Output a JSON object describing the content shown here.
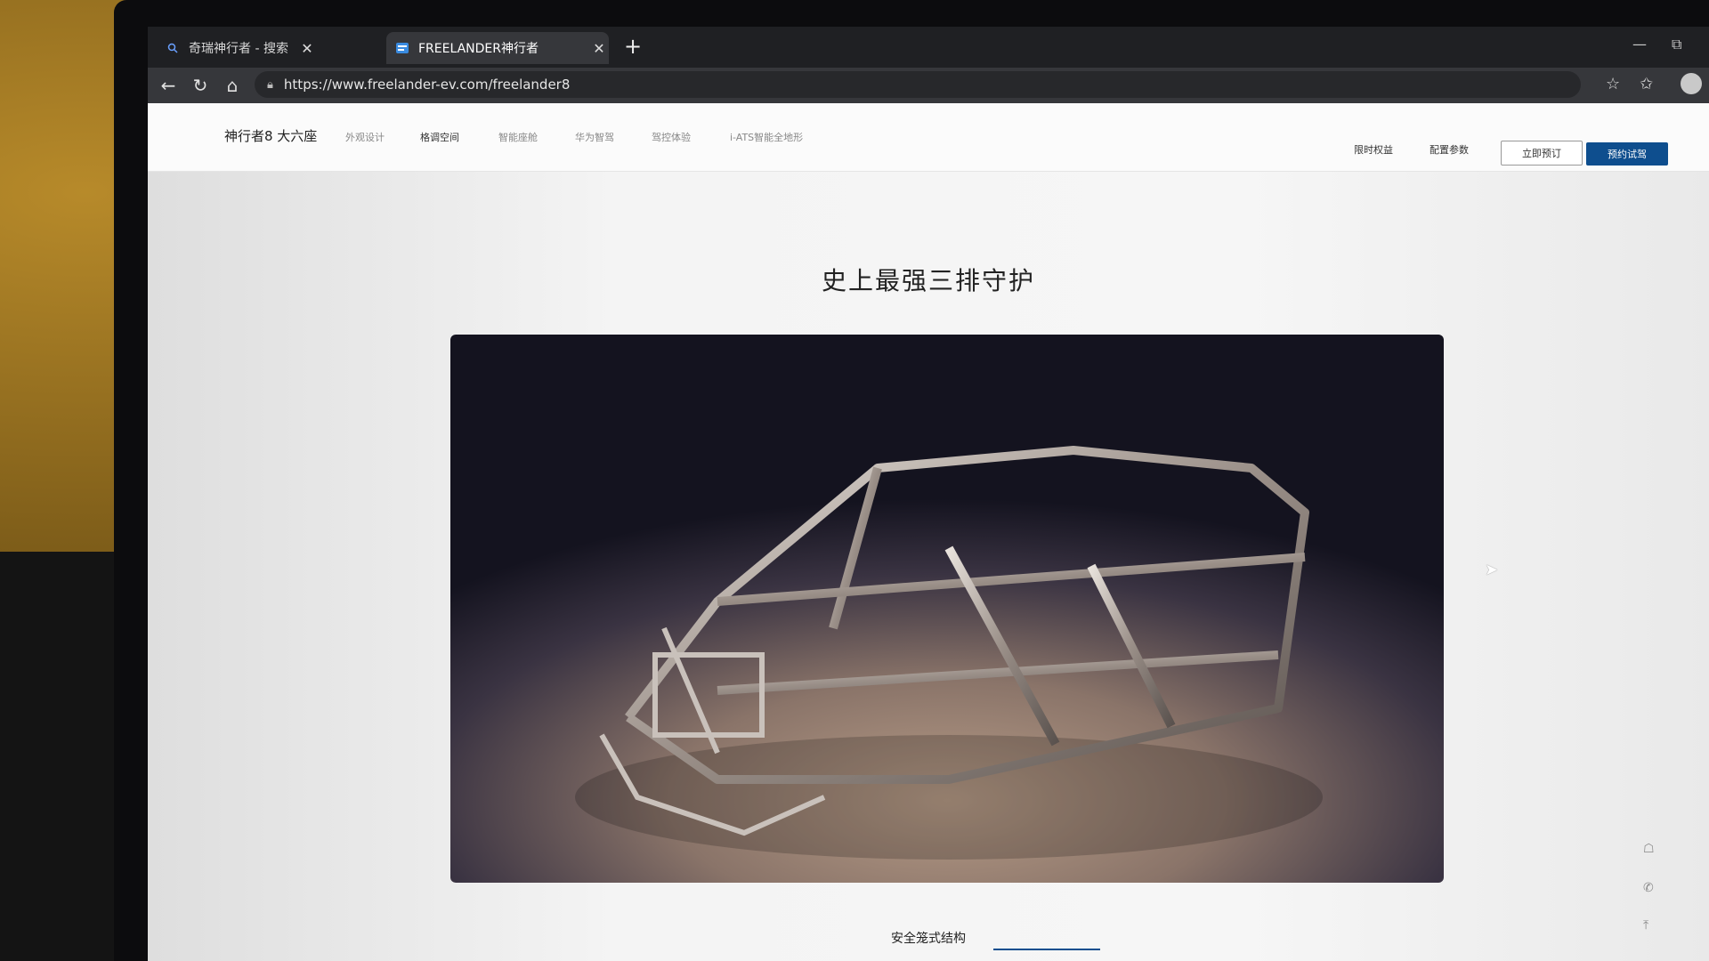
{
  "browser": {
    "tabs": [
      {
        "title": "奇瑞神行者 - 搜索",
        "favicon": "search-icon"
      },
      {
        "title": "FREELANDER神行者",
        "favicon": "site-favicon",
        "active": true
      }
    ],
    "url": "https://www.freelander-ev.com/freelander8"
  },
  "site": {
    "brand": "神行者8 大六座",
    "nav": [
      "外观设计",
      "格调空间",
      "智能座舱",
      "华为智驾",
      "驾控体验",
      "i-ATS智能全地形"
    ],
    "right_links": [
      "限时权益",
      "配置参数"
    ],
    "btn_order": "立即预订",
    "btn_test_drive": "预约试驾"
  },
  "content": {
    "headline": "史上最强三排守护",
    "caption": "安全笼式结构"
  },
  "colors": {
    "accent": "#0e4e8e"
  }
}
